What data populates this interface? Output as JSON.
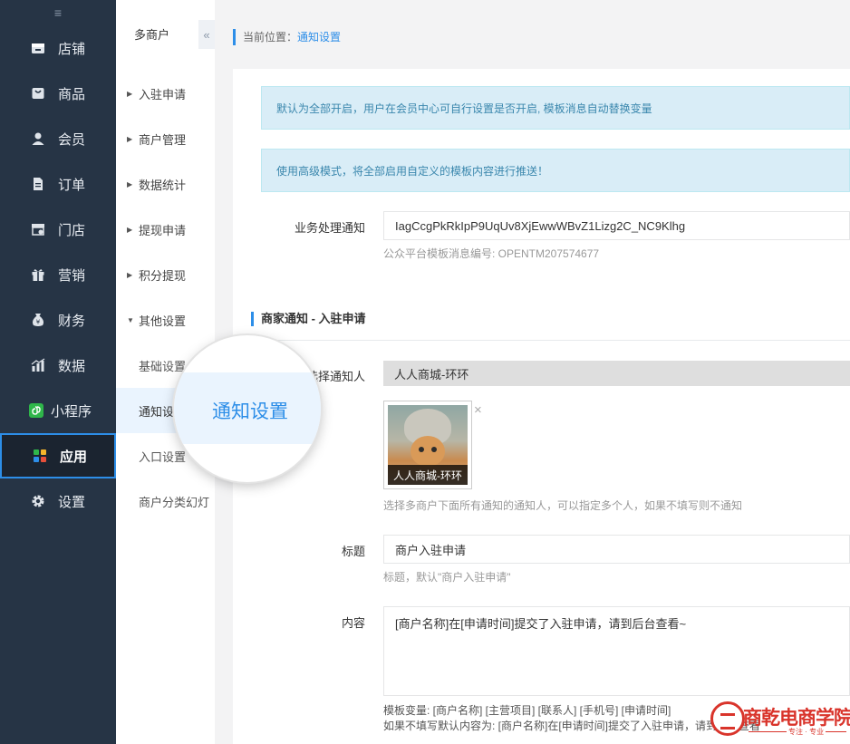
{
  "sidebar": {
    "collapse_glyph": "≡",
    "items": [
      {
        "label": "店铺",
        "icon": "store-icon"
      },
      {
        "label": "商品",
        "icon": "goods-icon"
      },
      {
        "label": "会员",
        "icon": "member-icon"
      },
      {
        "label": "订单",
        "icon": "order-icon"
      },
      {
        "label": "门店",
        "icon": "shop-icon"
      },
      {
        "label": "营销",
        "icon": "gift-icon"
      },
      {
        "label": "财务",
        "icon": "finance-icon"
      },
      {
        "label": "数据",
        "icon": "chart-icon"
      },
      {
        "label": "小程序",
        "icon": "miniapp-icon"
      },
      {
        "label": "应用",
        "icon": "apps-icon",
        "active": true
      },
      {
        "label": "设置",
        "icon": "gear-icon"
      }
    ]
  },
  "subnav": {
    "title": "多商户",
    "collapse_glyph": "«",
    "groups": [
      {
        "label": "入驻申请",
        "arrow": "▶"
      },
      {
        "label": "商户管理",
        "arrow": "▶"
      },
      {
        "label": "数据统计",
        "arrow": "▶"
      },
      {
        "label": "提现申请",
        "arrow": "▶"
      },
      {
        "label": "积分提现",
        "arrow": "▶"
      },
      {
        "label": "其他设置",
        "arrow": "▼"
      }
    ],
    "children": [
      {
        "label": "基础设置"
      },
      {
        "label": "通知设",
        "active": true
      },
      {
        "label": "入口设置"
      },
      {
        "label": "商户分类幻灯"
      }
    ],
    "magnifier_text": "通知设置"
  },
  "breadcrumb": {
    "prefix": "当前位置：",
    "current": "通知设置"
  },
  "alerts": {
    "a1": "默认为全部开启，用户在会员中心可自行设置是否开启, 模板消息自动替换变量",
    "a2": "使用高级模式，将全部启用自定义的模板内容进行推送！"
  },
  "business": {
    "label": "业务处理通知",
    "value": "IagCcgPkRkIpP9UqUv8XjEwwWBvZ1Lizg2C_NC9Klhg",
    "help": "公众平台模板消息编号: OPENTM207574677"
  },
  "section": {
    "title": "商家通知 - 入驻申请"
  },
  "notifier": {
    "label": "选择通知人",
    "value": "人人商城-环环",
    "card_name": "人人商城-环环",
    "remove_glyph": "×",
    "help": "选择多商户下面所有通知的通知人，可以指定多个人，如果不填写则不通知"
  },
  "title_field": {
    "label": "标题",
    "value": "商户入驻申请",
    "help": "标题，默认\"商户入驻申请\""
  },
  "content_field": {
    "label": "内容",
    "value": "[商户名称]在[申请时间]提交了入驻申请，请到后台查看~",
    "help1": "模板变量: [商户名称] [主营项目] [联系人] [手机号] [申请时间]",
    "help2": "如果不填写默认内容为: [商户名称]在[申请时间]提交了入驻申请，请到后台查看"
  },
  "watermark": {
    "text": "商乾电商学院",
    "sub": "专注 · 专业"
  },
  "colors": {
    "sidebar_bg": "#263445",
    "accent": "#2d8ee8",
    "alert_bg": "#d9edf7",
    "alert_text": "#3a87ad"
  }
}
